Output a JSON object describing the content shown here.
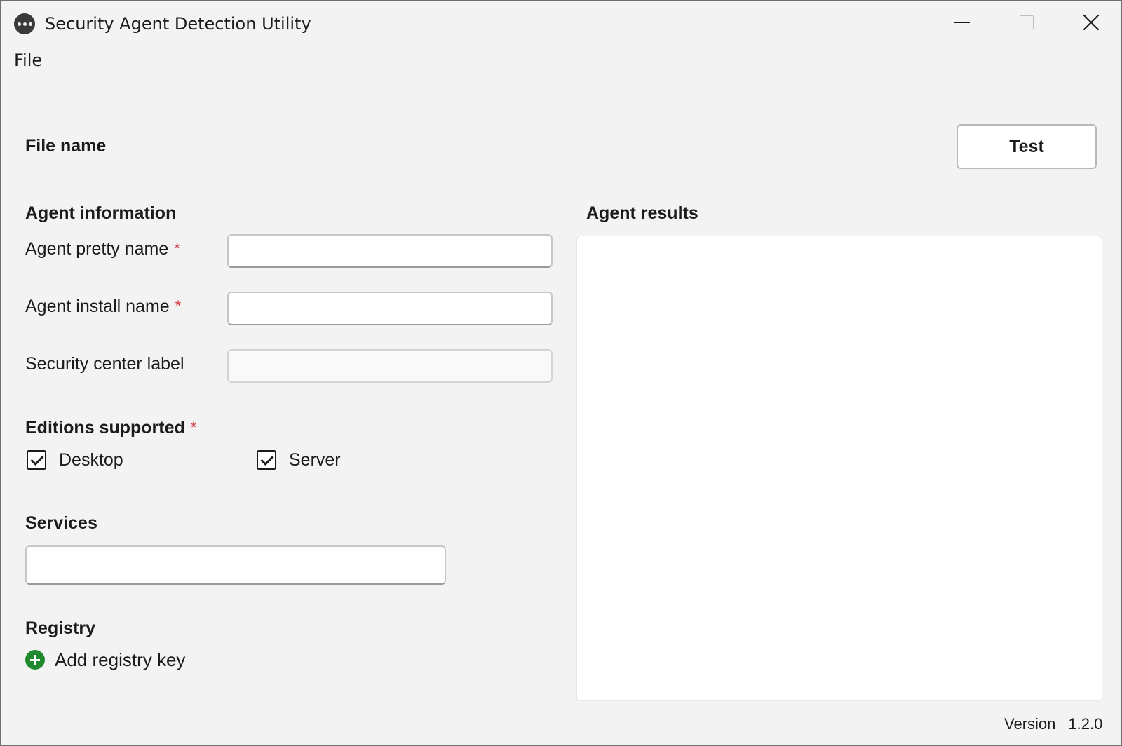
{
  "window": {
    "title": "Security Agent Detection Utility",
    "icon": "app-icon"
  },
  "menu": {
    "items": [
      {
        "label": "File"
      }
    ]
  },
  "header": {
    "file_name_label": "File name",
    "test_button_label": "Test"
  },
  "agent_info": {
    "section_title": "Agent information",
    "pretty_name_label": "Agent pretty name",
    "pretty_name_value": "",
    "install_name_label": "Agent install name",
    "install_name_value": "",
    "security_center_label": "Security center label",
    "security_center_value": "",
    "required_mark": "*"
  },
  "editions": {
    "section_title": "Editions supported",
    "required_mark": "*",
    "options": [
      {
        "label": "Desktop",
        "checked": true
      },
      {
        "label": "Server",
        "checked": true
      }
    ]
  },
  "services": {
    "section_title": "Services",
    "value": ""
  },
  "registry": {
    "section_title": "Registry",
    "add_label": "Add registry key",
    "add_icon": "plus-circle-icon",
    "add_icon_color": "#1e8a2d"
  },
  "results": {
    "section_title": "Agent results"
  },
  "footer": {
    "version_label": "Version",
    "version_value": "1.2.0"
  },
  "colors": {
    "required": "#d13438",
    "window_bg": "#f3f3f3"
  }
}
